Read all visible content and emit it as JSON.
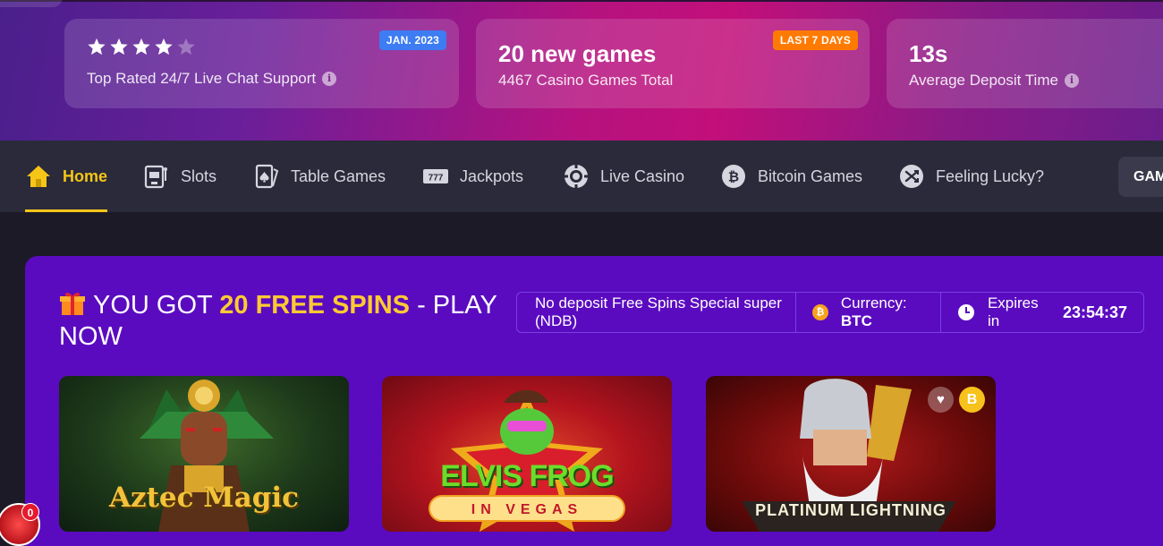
{
  "stats": [
    {
      "rating": 4,
      "rating_max": 5,
      "badge": "JAN. 2023",
      "subtitle": "Top Rated 24/7 Live Chat Support"
    },
    {
      "title": "20 new games",
      "badge": "LAST 7 DAYS",
      "subtitle": "4467 Casino Games Total"
    },
    {
      "title": "13s",
      "subtitle": "Average Deposit Time"
    }
  ],
  "nav": {
    "items": [
      {
        "label": "Home",
        "icon": "house-icon",
        "active": true
      },
      {
        "label": "Slots",
        "icon": "slot-machine-icon"
      },
      {
        "label": "Table Games",
        "icon": "playing-card-icon"
      },
      {
        "label": "Jackpots",
        "icon": "777-icon"
      },
      {
        "label": "Live Casino",
        "icon": "chip-icon"
      },
      {
        "label": "Bitcoin Games",
        "icon": "bitcoin-icon"
      },
      {
        "label": "Feeling Lucky?",
        "icon": "shuffle-icon"
      }
    ],
    "right_button": "GAM"
  },
  "promo": {
    "title_prefix": "YOU GOT",
    "title_highlight": "20 FREE SPINS",
    "title_suffix": "- PLAY NOW",
    "bonus_name": "No deposit Free Spins Special super (NDB)",
    "currency_label": "Currency:",
    "currency_value": "BTC",
    "expires_label": "Expires in",
    "expires_value": "23:54:37"
  },
  "games": [
    {
      "title": "Aztec Magic"
    },
    {
      "title": "ELVIS FROG",
      "subtitle": "IN VEGAS"
    },
    {
      "title": "PLATINUM LIGHTNING",
      "heart_icon": "heart-icon",
      "coin_label": "B"
    }
  ],
  "floating_widget": {
    "count": "0"
  },
  "colors": {
    "accent": "#f5c518",
    "promo_bg": "#5a0bc0",
    "nav_bg": "#2a2a3a",
    "badge_blue": "#3d7cf2",
    "badge_orange": "#ff7a00"
  }
}
